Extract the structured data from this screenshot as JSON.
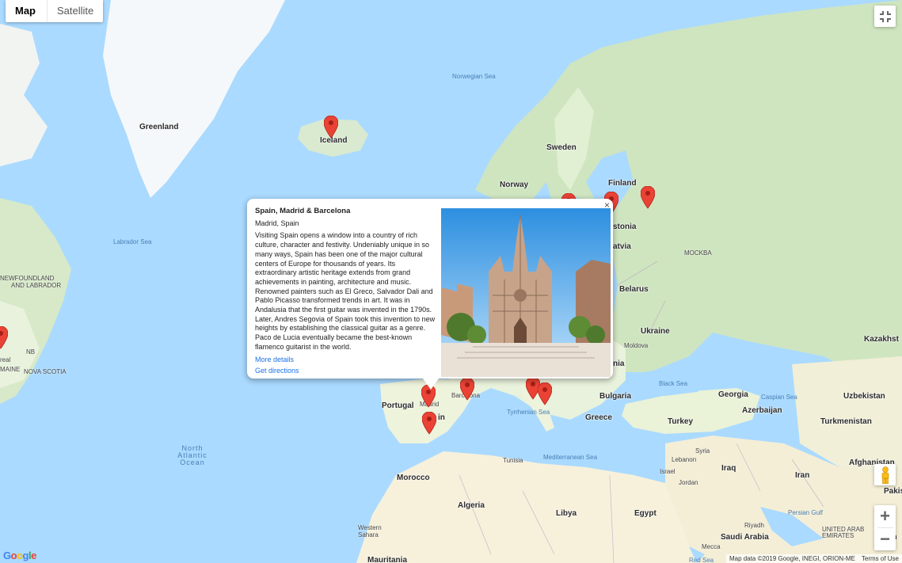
{
  "map_type": {
    "map_label": "Map",
    "satellite_label": "Satellite"
  },
  "labels": {
    "greenland": "Greenland",
    "iceland": "Iceland",
    "sweden": "Sweden",
    "finland": "Finland",
    "norway": "Norway",
    "norwegian_sea": "Norwegian Sea",
    "labrador_sea": "Labrador Sea",
    "newfoundland": "NEWFOUNDLAND\nAND LABRADOR",
    "nb": "NB",
    "maine": "MAINE",
    "nova_scotia": "NOVA SCOTIA",
    "real": "real",
    "estonia": "stonia",
    "latvia": "atvia",
    "belarus": "Belarus",
    "moscow": "MOCKBA",
    "ukraine": "Ukraine",
    "moldova": "Moldova",
    "romania": "nia",
    "kazakhstan": "Kazakhst",
    "black_sea": "Black Sea",
    "bulgaria": "Bulgaria",
    "georgia": "Georgia",
    "caspian_sea": "Caspian Sea",
    "azerbaijan": "Azerbaijan",
    "uzbekistan": "Uzbekistan",
    "turkmenistan": "Turkmenistan",
    "turkey": "Turkey",
    "greece": "Greece",
    "syria": "Syria",
    "lebanon": "Lebanon",
    "iraq": "Iraq",
    "iran": "Iran",
    "afghanistan": "Afghanistan",
    "pakistan": "Pakis",
    "jordan": "Jordan",
    "israel": "Israel",
    "persian_gulf": "Persian Gulf",
    "saudi_arabia": "Saudi Arabia",
    "egypt": "Egypt",
    "libya": "Libya",
    "algeria": "Algeria",
    "morocco": "Morocco",
    "tunisia": "Tunisia",
    "western_sahara": "Western\nSahara",
    "mauritania": "Mauritania",
    "mediterranean": "Mediterranean Sea",
    "tyrrhenian": "Tyrrhenian Sea",
    "portugal": "Portugal",
    "spain": "in",
    "madrid": "Madrid",
    "barcelona": "Barcelona",
    "italy": "It",
    "north_atlantic": "North\nAtlantic\nOcean",
    "red_sea": "Red Sea",
    "uae": "UNITED ARAB\nEMIRATES",
    "oman": "Om",
    "riyadh": "Riyadh",
    "mecca": "Mecca"
  },
  "info_window": {
    "title": "Spain, Madrid & Barcelona",
    "subtitle": "Madrid, Spain",
    "description": "Visiting Spain opens a window into a country of rich culture, character and festivity. Undeniably unique in so many ways, Spain has been one of the major cultural centers of Europe for thousands of years. Its extraordinary artistic heritage extends from grand achievements in painting, architecture and music. Renowned painters such as El Greco, Salvador Dali and Pablo Picasso transformed trends in art. It was in Andalusia that the first guitar was invented in the 1790s. Later, Andres Segovia of Spain took this invention to new heights by establishing the classical guitar as a genre. Paco de Lucia eventually became the best-known flamenco guitarist in the world.",
    "more_details": "More details",
    "get_directions": "Get directions",
    "close": "×"
  },
  "attribution": {
    "map_data": "Map data ©2019 Google, INEGI, ORION-ME",
    "terms": "Terms of Use"
  },
  "logo": "Google",
  "colors": {
    "water": "#aadaff",
    "land": "#e8f2dc",
    "land_green": "#cfe5c0",
    "desert": "#f7f1dc",
    "ice": "#f5f8fa",
    "pin": "#ea4335"
  }
}
